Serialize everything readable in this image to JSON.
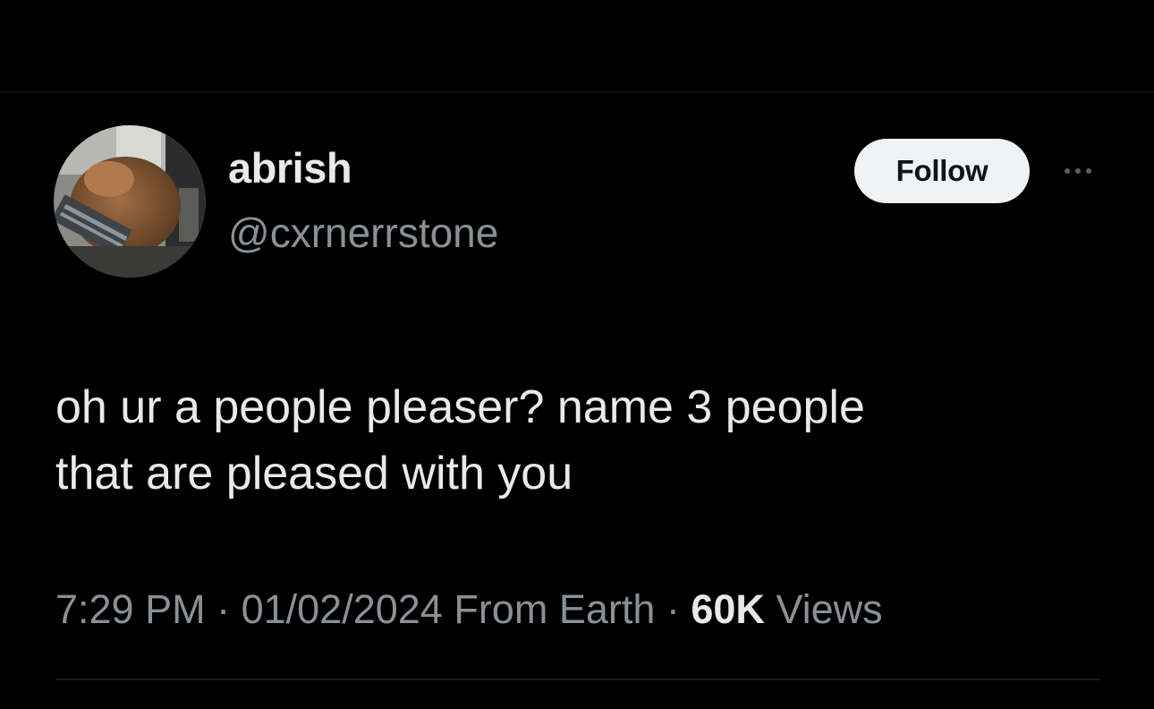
{
  "author": {
    "display_name": "abrish",
    "handle": "@cxrnerrstone"
  },
  "actions": {
    "follow_label": "Follow",
    "more_icon": "more-horizontal-icon"
  },
  "tweet": {
    "text_line_1": "oh ur a people pleaser? name 3 people",
    "text_line_2": "that are pleased with you"
  },
  "meta": {
    "time": "7:29 PM",
    "separator": " · ",
    "date": "01/02/2024",
    "source": " From Earth",
    "views_count": "60K",
    "views_label": " Views"
  },
  "colors": {
    "background": "#000000",
    "primary_text": "#e7e9ea",
    "secondary_text": "#8b9096",
    "follow_bg": "#eff3f4"
  }
}
